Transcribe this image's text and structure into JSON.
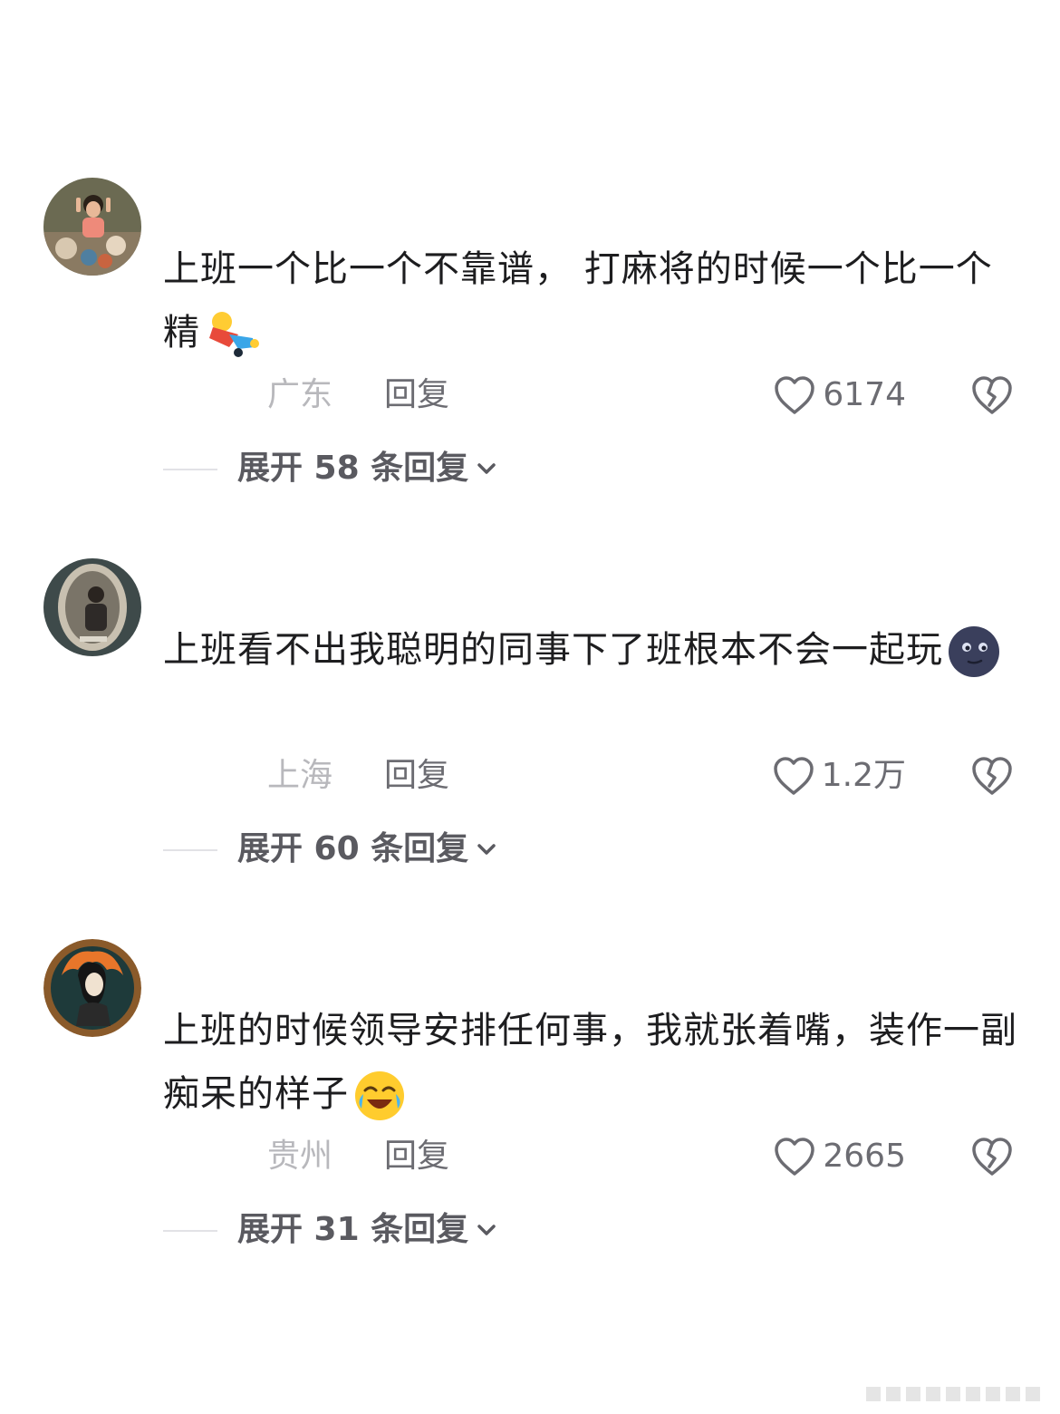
{
  "comments": [
    {
      "text": "上班一个比一个不靠谱， 打麻将的时候一个比一个精",
      "emoji": "lying-down-emoji",
      "location": "广东",
      "reply_label": "回复",
      "like_count": "6174",
      "expand_label": "展开 58 条回复"
    },
    {
      "text": "上班看不出我聪明的同事下了班根本不会一起玩",
      "emoji": "dark-moon-face-emoji",
      "location": "上海",
      "reply_label": "回复",
      "like_count": "1.2万",
      "expand_label": "展开 60 条回复"
    },
    {
      "text": "上班的时候领导安排任何事，我就张着嘴，装作一副痴呆的样子",
      "emoji": "rolling-laughing-emoji",
      "location": "贵州",
      "reply_label": "回复",
      "like_count": "2665",
      "expand_label": "展开 31 条回复"
    }
  ],
  "icons": {
    "like": "heart-outline-icon",
    "dislike": "broken-heart-icon",
    "expand": "chevron-down-icon"
  },
  "colors": {
    "text": "#1d1d1f",
    "secondary": "#6c6c72",
    "location": "#b8b8bc",
    "divider": "#e2e2e6"
  }
}
